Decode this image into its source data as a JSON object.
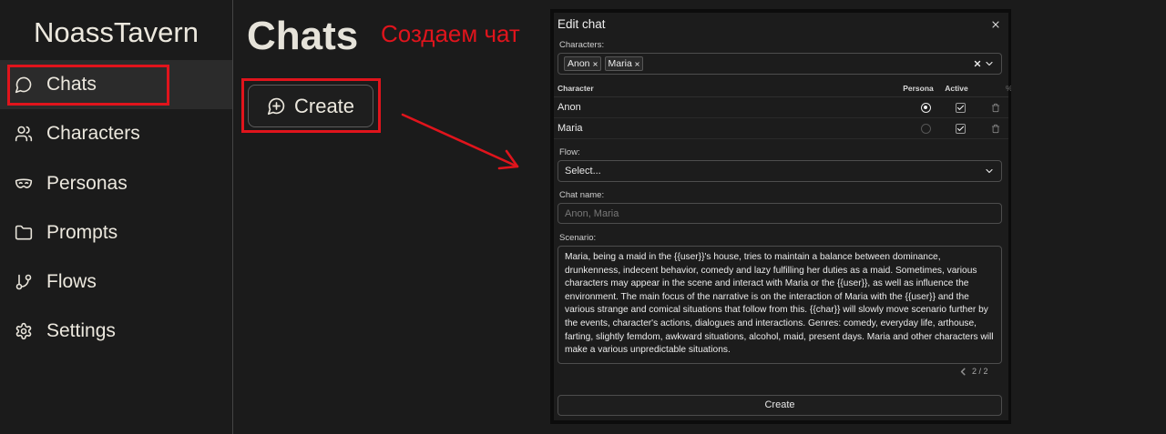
{
  "app": {
    "title": "NoassTavern"
  },
  "sidebar": {
    "items": [
      {
        "label": "Chats",
        "icon": "chat-bubble-icon",
        "active": true
      },
      {
        "label": "Characters",
        "icon": "users-icon",
        "active": false
      },
      {
        "label": "Personas",
        "icon": "mask-icon",
        "active": false
      },
      {
        "label": "Prompts",
        "icon": "folder-icon",
        "active": false
      },
      {
        "label": "Flows",
        "icon": "git-branch-icon",
        "active": false
      },
      {
        "label": "Settings",
        "icon": "gear-icon",
        "active": false
      }
    ]
  },
  "main": {
    "title": "Chats",
    "create_label": "Create",
    "create_icon": "chat-plus-icon"
  },
  "annotation": {
    "text": "Создаем чат",
    "color": "#e0141c"
  },
  "modal": {
    "title": "Edit chat",
    "close_icon": "close-icon",
    "characters": {
      "label": "Characters:",
      "selected": [
        "Anon",
        "Maria"
      ]
    },
    "table": {
      "headers": {
        "character": "Character",
        "persona": "Persona",
        "active": "Active",
        "extra": "%"
      },
      "rows": [
        {
          "name": "Anon",
          "persona": true,
          "active": true
        },
        {
          "name": "Maria",
          "persona": false,
          "active": true
        }
      ]
    },
    "flow": {
      "label": "Flow:",
      "value": "Select..."
    },
    "chat_name": {
      "label": "Chat name:",
      "placeholder": "Anon, Maria"
    },
    "scenario": {
      "label": "Scenario:",
      "value": "Maria, being a maid in the {{user}}'s house, tries to maintain a balance between dominance, drunkenness, indecent behavior, comedy and lazy fulfilling her duties as a maid. Sometimes, various characters may appear in the scene and interact with Maria or the {{user}}, as well as influence the environment. The main focus of the narrative is on the interaction of Maria with the {{user}} and the various strange and comical situations that follow from this. {{char}} will slowly move scenario further by the events, character's actions, dialogues and interactions. Genres: comedy, everyday life, arthouse, farting, slightly femdom, awkward situations, alcohol, maid, present days. Maria and other characters will make a various unpredictable situations."
    },
    "pagination": {
      "text": "2 / 2"
    },
    "submit_label": "Create"
  },
  "colors": {
    "background": "#1b1b1b",
    "sidebar_active": "#2b2b2b",
    "text": "#ebe7dd",
    "modal_frame": "#0c0c0c",
    "annotation_red": "#e0141c"
  }
}
